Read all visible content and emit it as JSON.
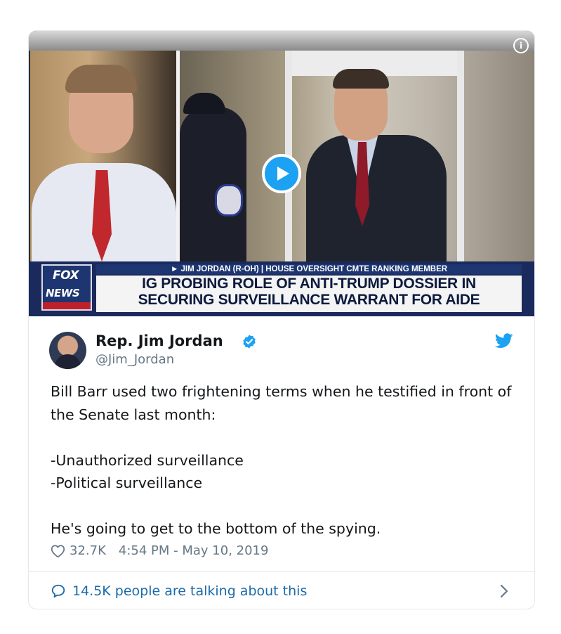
{
  "media": {
    "chyron_top": "► JIM JORDAN (R-OH) | HOUSE OVERSIGHT CMTE RANKING MEMBER",
    "chyron_line1": "IG PROBING ROLE OF ANTI-TRUMP DOSSIER IN",
    "chyron_line2": "SECURING SURVEILLANCE WARRANT FOR AIDE",
    "logo_fox": "FOX",
    "logo_news": "NEWS",
    "info_icon": "i"
  },
  "author": {
    "name": "Rep. Jim Jordan",
    "handle": "@Jim_Jordan"
  },
  "tweet": {
    "text": "Bill Barr used two frightening terms when he testified in front of the Senate last month:\n\n-Unauthorized surveillance\n-Political surveillance\n\nHe's going to get to the bottom of the spying."
  },
  "meta": {
    "likes": "32.7K",
    "timestamp": "4:54 PM - May 10, 2019"
  },
  "footer": {
    "talking": "14.5K people are talking about this"
  },
  "icons": {
    "verified": "verified-badge-icon",
    "bird": "twitter-bird-icon",
    "heart": "heart-icon",
    "bubble": "speech-bubble-icon",
    "chevron": "chevron-right-icon",
    "play": "play-icon",
    "info": "info-icon"
  },
  "colors": {
    "accent": "#1da1f2",
    "link": "#1b6aa8",
    "muted": "#657786",
    "text": "#14171a",
    "border": "#e1e8ed"
  }
}
